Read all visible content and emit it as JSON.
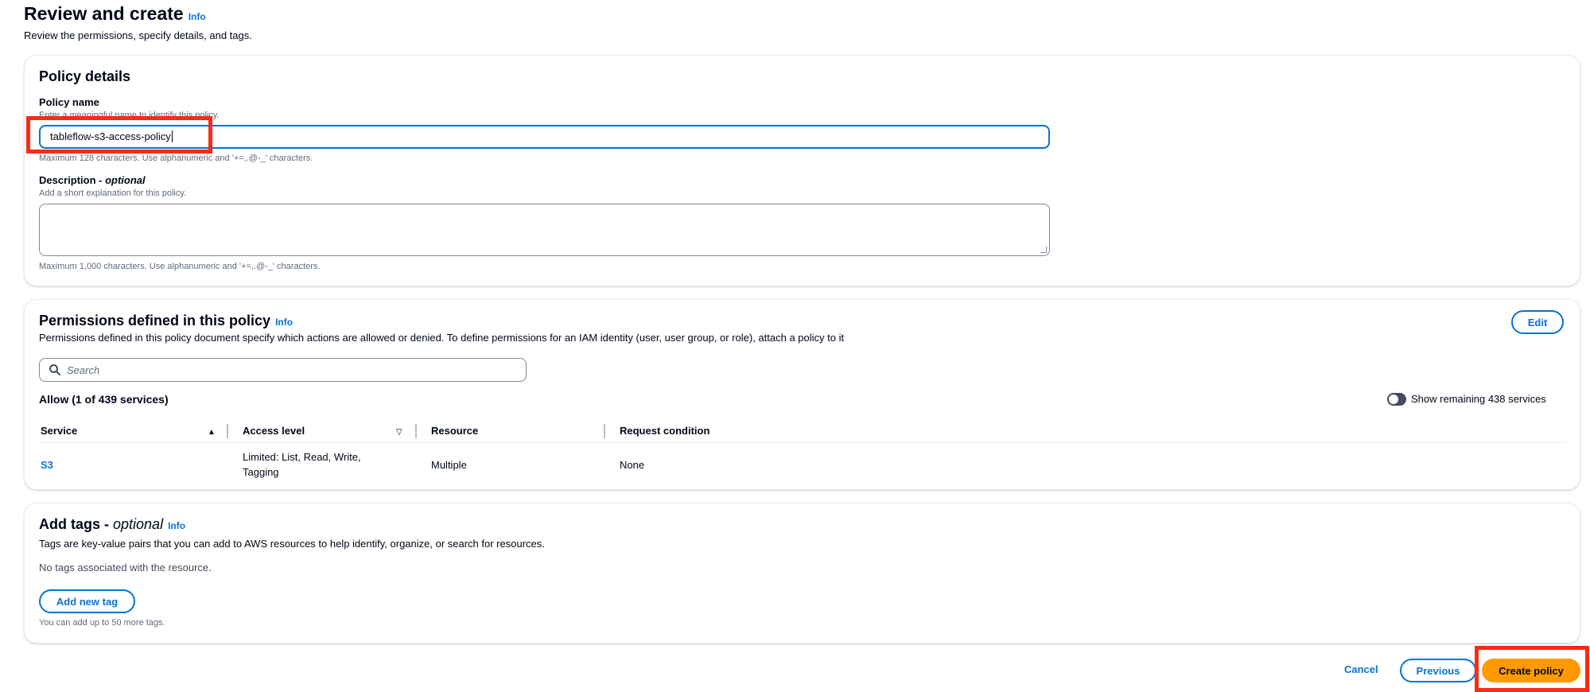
{
  "header": {
    "title": "Review and create",
    "info": "Info",
    "subtitle": "Review the permissions, specify details, and tags."
  },
  "policy_details": {
    "heading": "Policy details",
    "name_label": "Policy name",
    "name_hint": "Enter a meaningful name to identify this policy.",
    "name_value": "tableflow-s3-access-policy",
    "name_constraint": "Maximum 128 characters. Use alphanumeric and '+=,.@-_' characters.",
    "desc_label": "Description",
    "desc_optional": "optional",
    "desc_hint": "Add a short explanation for this policy.",
    "desc_value": "",
    "desc_constraint": "Maximum 1,000 characters. Use alphanumeric and '+=,.@-_' characters."
  },
  "permissions": {
    "heading": "Permissions defined in this policy",
    "info": "Info",
    "edit_label": "Edit",
    "description": "Permissions defined in this policy document specify which actions are allowed or denied. To define permissions for an IAM identity (user, user group, or role), attach a policy to it",
    "search_placeholder": "Search",
    "allow_title": "Allow (1 of 439 services)",
    "toggle_label": "Show remaining 438 services",
    "toggle_on": false,
    "columns": [
      "Service",
      "Access level",
      "Resource",
      "Request condition"
    ],
    "rows": [
      {
        "service": "S3",
        "access_line1": "Limited: List, Read, Write,",
        "access_line2": "Tagging",
        "resource": "Multiple",
        "condition": "None"
      }
    ]
  },
  "tags": {
    "heading": "Add tags",
    "optional": "optional",
    "info": "Info",
    "description": "Tags are key-value pairs that you can add to AWS resources to help identify, organize, or search for resources.",
    "empty": "No tags associated with the resource.",
    "add_label": "Add new tag",
    "limit": "You can add up to 50 more tags."
  },
  "footer": {
    "cancel": "Cancel",
    "previous": "Previous",
    "create": "Create policy"
  },
  "colors": {
    "link": "#0972d3",
    "primary": "#ff9900",
    "highlight": "#ff2a15"
  }
}
